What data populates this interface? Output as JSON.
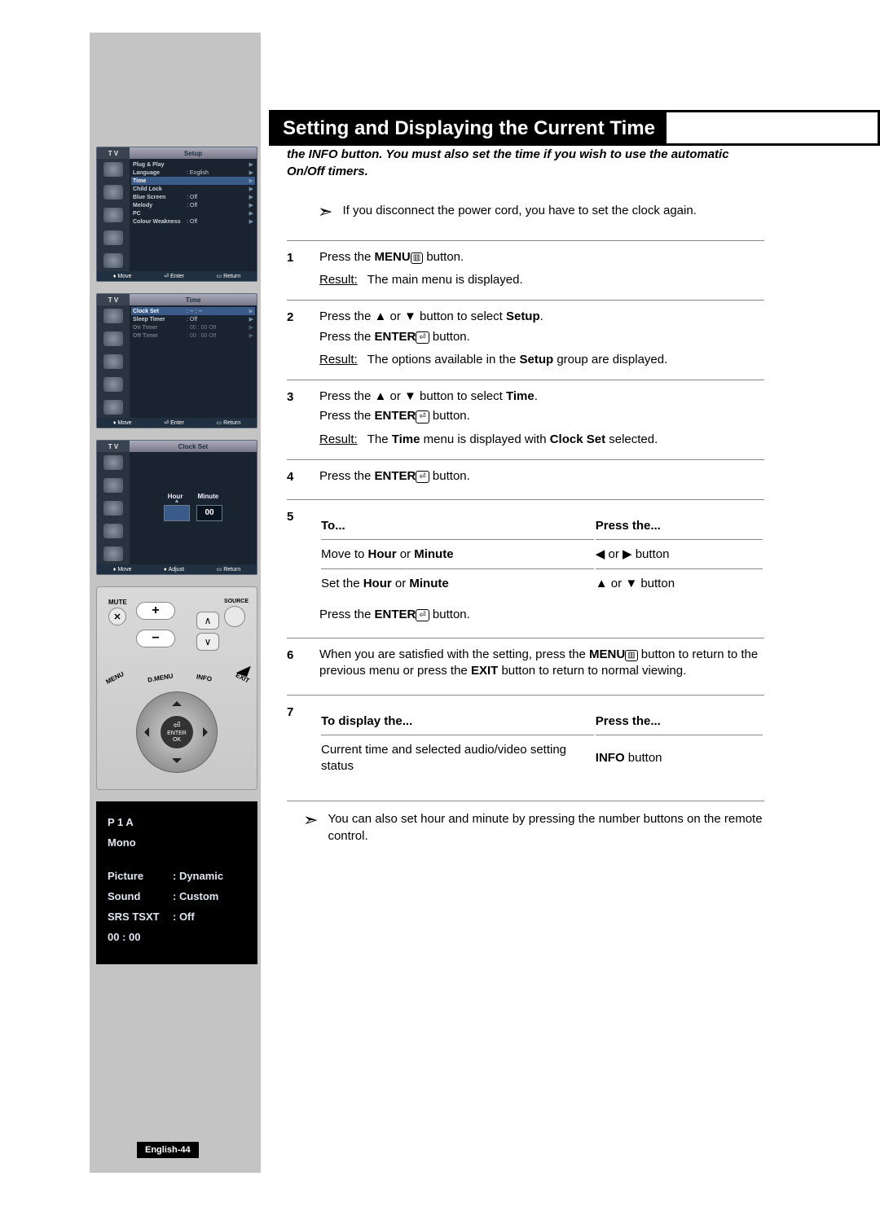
{
  "page_title": "Setting and Displaying the Current Time",
  "page_number": "English-44",
  "intro": "You can set the TV's clock so that the current time is displayed when you press the INFO button. You must also set the time if you wish to use the automatic On/Off timers.",
  "cord_note": "If you disconnect the power cord, you have to set the clock again.",
  "footer_note": "You can also set hour and minute by pressing the number buttons on the remote control.",
  "osd1": {
    "tv": "T V",
    "title": "Setup",
    "rows": [
      {
        "label": "Plug & Play",
        "val": "",
        "caret": "▶"
      },
      {
        "label": "Language",
        "val": ": English",
        "caret": "▶"
      },
      {
        "label": "Time",
        "val": "",
        "caret": "▶",
        "hl": true
      },
      {
        "label": "Child Lock",
        "val": "",
        "caret": "▶"
      },
      {
        "label": "Blue Screen",
        "val": ": Off",
        "caret": "▶"
      },
      {
        "label": "Melody",
        "val": ": Off",
        "caret": "▶"
      },
      {
        "label": "PC",
        "val": "",
        "caret": "▶"
      },
      {
        "label": "Colour Weakness",
        "val": ": Off",
        "caret": "▶"
      }
    ],
    "footer": {
      "move": "Move",
      "enter": "Enter",
      "return": "Return"
    }
  },
  "osd2": {
    "tv": "T V",
    "title": "Time",
    "rows": [
      {
        "label": "Clock Set",
        "val": ": -- : --",
        "caret": "▶",
        "hl": true
      },
      {
        "label": "Sleep Timer",
        "val": ": Off",
        "caret": "▶"
      },
      {
        "label": "On Timer",
        "val": ": 00 : 00    Off",
        "caret": "▶",
        "dim": true
      },
      {
        "label": "Off Timer",
        "val": ": 00 : 00    Off",
        "caret": "▶",
        "dim": true
      }
    ],
    "footer": {
      "move": "Move",
      "enter": "Enter",
      "return": "Return"
    }
  },
  "osd3": {
    "tv": "T V",
    "title": "Clock Set",
    "hour_label": "Hour",
    "minute_label": "Minute",
    "hour_val": "",
    "minute_val": "00",
    "footer": {
      "move": "Move",
      "adjust": "Adjust",
      "return": "Return"
    }
  },
  "remote": {
    "mute": "MUTE",
    "source": "SOURCE",
    "menu": "MENU",
    "dmenu": "D.MENU",
    "info": "INFO",
    "exit": "EXIT",
    "enter": "ENTER",
    "ok": "OK"
  },
  "info_panel": {
    "prog": "P  1    A",
    "mono": "Mono",
    "rows": [
      {
        "k": "Picture",
        "v": ": Dynamic"
      },
      {
        "k": "Sound",
        "v": ": Custom"
      },
      {
        "k": "SRS TSXT",
        "v": ": Off"
      },
      {
        "k": "00 : 00",
        "v": ""
      }
    ]
  },
  "steps": {
    "s1": {
      "num": "1",
      "l1_a": "Press the ",
      "l1_b": "MENU",
      "l1_c": " button.",
      "result": "The main menu is displayed.",
      "result_label": "Result"
    },
    "s2": {
      "num": "2",
      "l1": "Press the ▲ or ▼ button to select ",
      "l1b": "Setup",
      "l1c": ".",
      "l2a": "Press the ",
      "l2b": "ENTER",
      "l2c": " button.",
      "result_label": "Result",
      "result_a": "The options available in the ",
      "result_b": "Setup",
      "result_c": " group are displayed."
    },
    "s3": {
      "num": "3",
      "l1": "Press the ▲ or ▼ button to select ",
      "l1b": "Time",
      "l1c": ".",
      "l2a": "Press the ",
      "l2b": "ENTER",
      "l2c": " button.",
      "result_label": "Result",
      "result_a": "The ",
      "result_b": "Time",
      "result_c": " menu is displayed with ",
      "result_d": "Clock Set",
      "result_e": " selected."
    },
    "s4": {
      "num": "4",
      "l1a": "Press the ",
      "l1b": "ENTER",
      "l1c": " button."
    },
    "s5": {
      "num": "5",
      "th1": "To...",
      "th2": "Press the...",
      "r1a": "Move to ",
      "r1b": "Hour",
      "r1c": " or ",
      "r1d": "Minute",
      "r1v": "◀ or ▶ button",
      "r2a": "Set the ",
      "r2b": "Hour",
      "r2c": " or ",
      "r2d": "Minute",
      "r2v": "▲ or ▼ button",
      "l3a": "Press the ",
      "l3b": "ENTER",
      "l3c": " button."
    },
    "s6": {
      "num": "6",
      "t": "When you are satisfied with the setting, press the ",
      "t2": "MENU",
      "t3": " button to return to the previous menu or press the ",
      "t4": "EXIT",
      "t5": " button to return to normal viewing."
    },
    "s7": {
      "num": "7",
      "th1": "To display the...",
      "th2": "Press the...",
      "r1": "Current time and selected audio/video setting status",
      "r1v_a": "INFO",
      "r1v_b": " button"
    }
  }
}
